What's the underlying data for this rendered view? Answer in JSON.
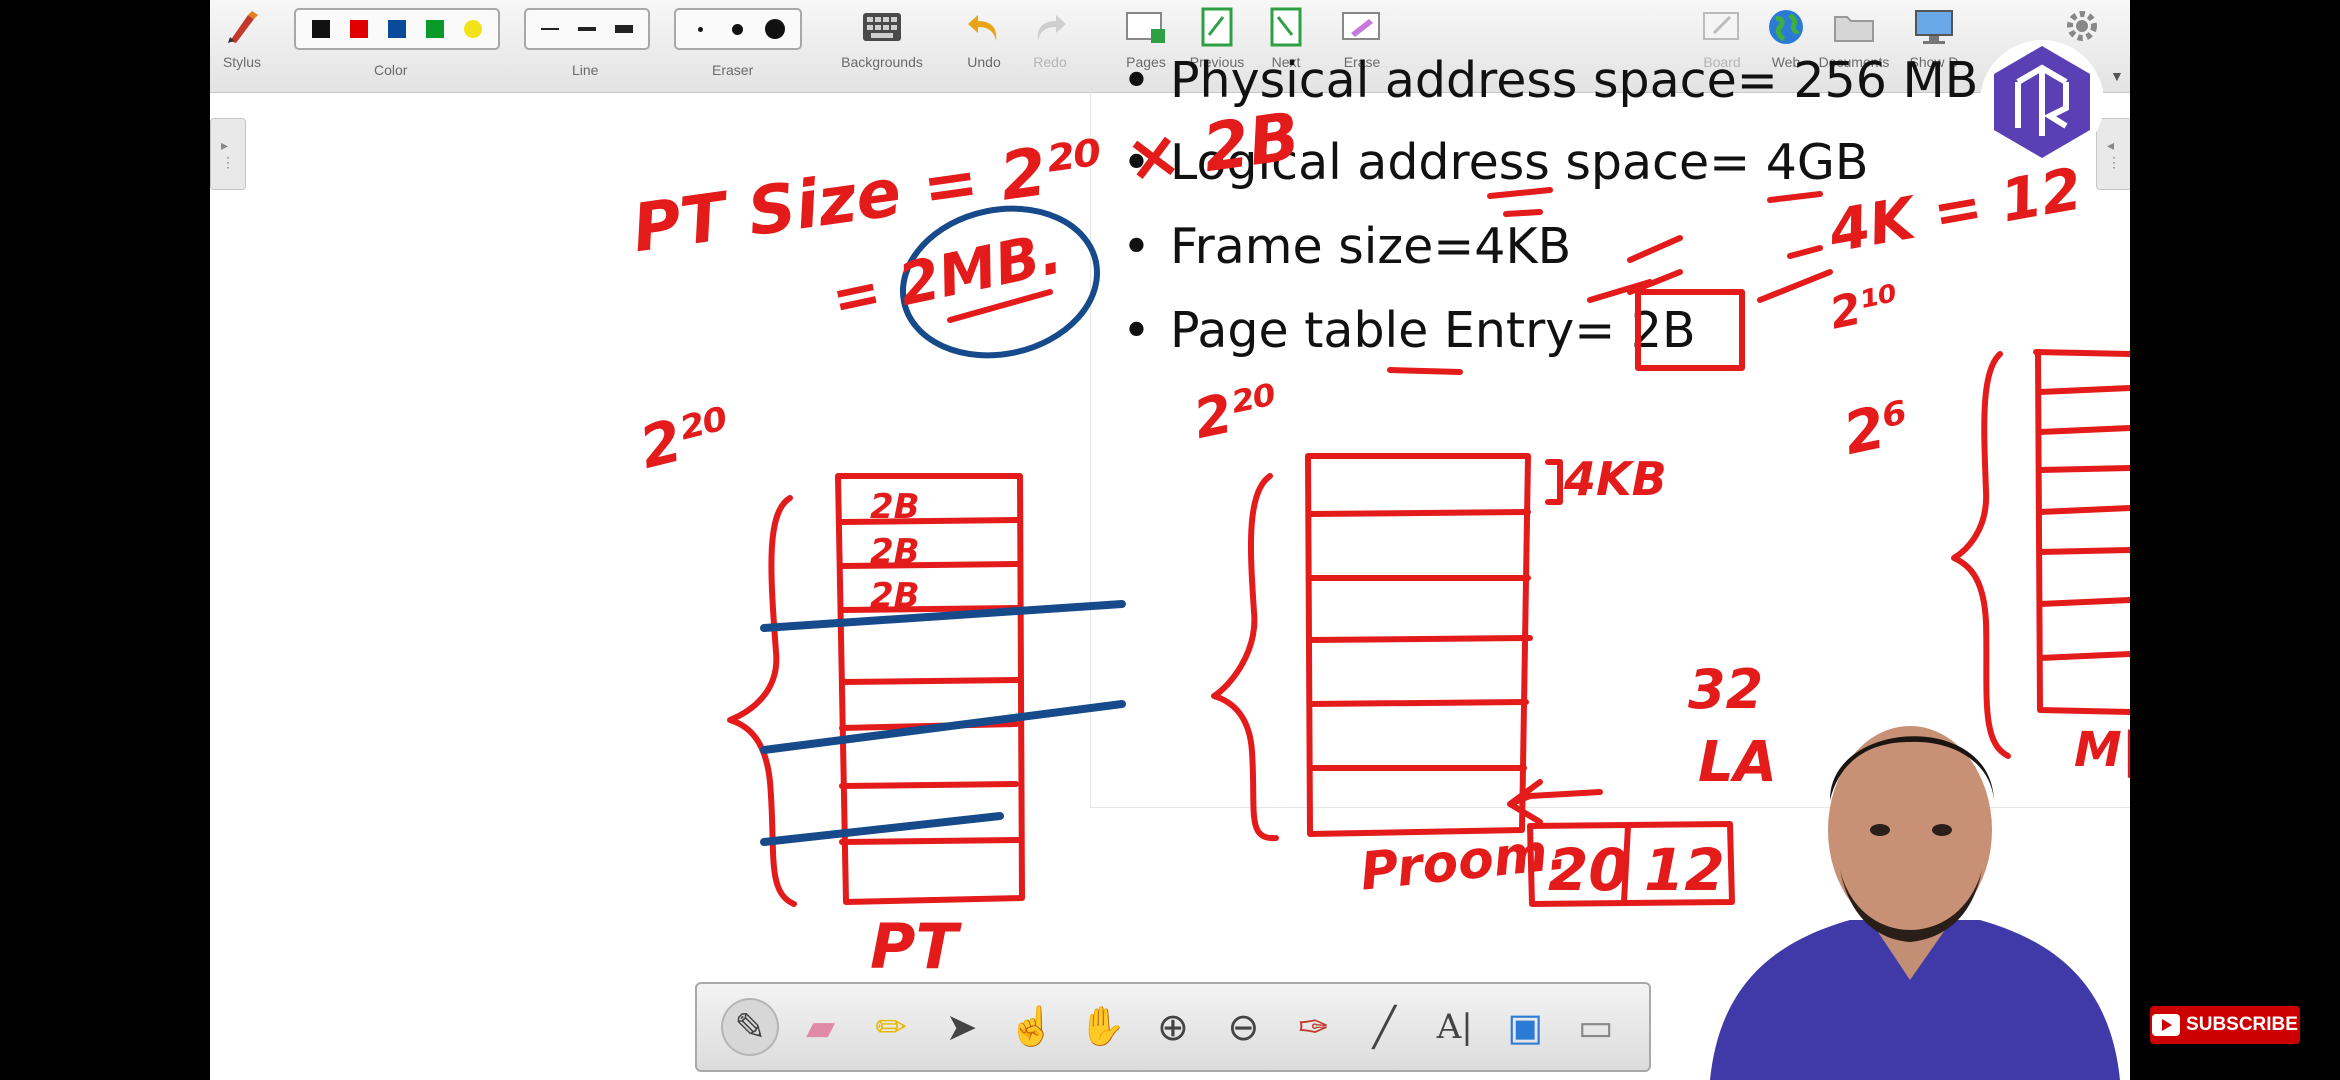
{
  "toolbar": {
    "stylus": "Stylus",
    "color": "Color",
    "line": "Line",
    "eraser": "Eraser",
    "backgrounds": "Backgrounds",
    "undo": "Undo",
    "redo": "Redo",
    "pages": "Pages",
    "previous": "Previous",
    "next": "Next",
    "erase": "Erase",
    "board": "Board",
    "web": "Web",
    "documents": "Documents",
    "show_desktop": "Show D"
  },
  "colors": [
    "#111111",
    "#e00000",
    "#0a4a9a",
    "#0a9a2a",
    "#f2e21a"
  ],
  "slide": {
    "bullets": [
      "Physical address space= 256 MB",
      "Logical address space= 4GB",
      "Frame size=4KB",
      "Page table Entry= 2B"
    ]
  },
  "annotations": {
    "pt_size": "PT Size = 2²⁰ × 2B",
    "equals_2mb": "= 2MB.",
    "two_pow_20_a": "2²⁰",
    "two_pow_20_b": "2²⁰",
    "two_pow_6": "2⁶",
    "entry_2b": [
      "2B",
      "2B",
      "2B"
    ],
    "pt_label": "PT",
    "proom_label": "Proom.",
    "four_kb": "4KB",
    "thirty_two": "32",
    "la": "LA",
    "la_fields": [
      "20",
      "12"
    ],
    "four_k_eq": "4K = 12",
    "two_pow_10": "2¹⁰",
    "m_label": "M|",
    "ink_red": "#e31b1b",
    "ink_blue": "#174a8a"
  },
  "bottom_tools": [
    "pen-tool",
    "highlighter-eraser",
    "highlighter",
    "pointer",
    "hand-pointer",
    "pan-hand",
    "zoom-in",
    "zoom-out",
    "laser-pen",
    "line-tool",
    "text-tool",
    "screen-capture",
    "keyboard"
  ],
  "subscribe": "SUBSCRIBE"
}
